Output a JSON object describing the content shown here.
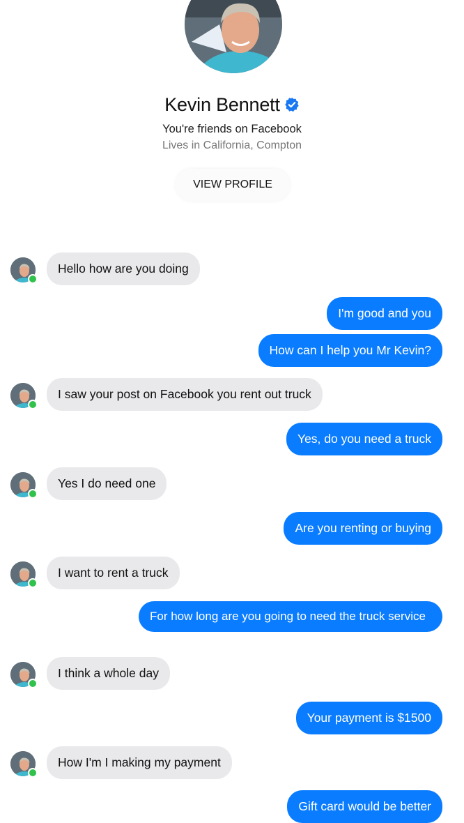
{
  "profile": {
    "name": "Kevin Bennett",
    "friends_text": "You're friends on Facebook",
    "location_text": "Lives in California, Compton",
    "view_profile_label": "VIEW PROFILE",
    "verified_icon": "verified-badge-icon",
    "online_status": "online"
  },
  "colors": {
    "outgoing_bubble": "#0a7cff",
    "incoming_bubble": "#e9e9eb",
    "verified_badge": "#1877f2",
    "online_dot": "#31c24d"
  },
  "messages": [
    {
      "direction": "incoming",
      "text": "Hello how are you doing"
    },
    {
      "direction": "outgoing",
      "text": "I'm good and you"
    },
    {
      "direction": "outgoing",
      "text": "How can I help you Mr Kevin?"
    },
    {
      "direction": "incoming",
      "text": "I saw your post on Facebook you rent out truck"
    },
    {
      "direction": "outgoing",
      "text": "Yes, do you need a truck"
    },
    {
      "direction": "incoming",
      "text": "Yes I do need one"
    },
    {
      "direction": "outgoing",
      "text": "Are you renting or buying"
    },
    {
      "direction": "incoming",
      "text": "I want to rent a truck"
    },
    {
      "direction": "outgoing",
      "text": "For how long are you going to need the truck service"
    },
    {
      "direction": "incoming",
      "text": "I think a whole day"
    },
    {
      "direction": "outgoing",
      "text": "Your payment is $1500"
    },
    {
      "direction": "incoming",
      "text": "How I'm I making my payment"
    },
    {
      "direction": "outgoing",
      "text": "Gift card would be better"
    }
  ]
}
